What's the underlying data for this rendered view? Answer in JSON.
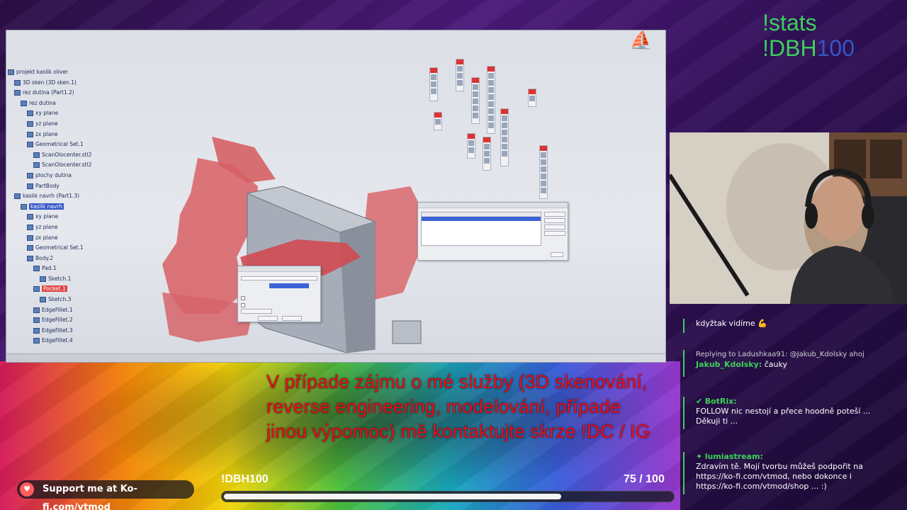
{
  "cad": {
    "tree": [
      {
        "label": "projekt kaslik oliver",
        "indent": 0
      },
      {
        "label": "3D sken (3D sken.1)",
        "indent": 1
      },
      {
        "label": "rez dutina (Part1.2)",
        "indent": 1
      },
      {
        "label": "rez dutina",
        "indent": 2
      },
      {
        "label": "xy plane",
        "indent": 3
      },
      {
        "label": "yz plane",
        "indent": 3
      },
      {
        "label": "zx plane",
        "indent": 3
      },
      {
        "label": "Geometrical Set.1",
        "indent": 3
      },
      {
        "label": "ScanOlocenter.stl2",
        "indent": 4
      },
      {
        "label": "ScanOlocenter.stl2",
        "indent": 4
      },
      {
        "label": "plochy dutina",
        "indent": 3
      },
      {
        "label": "PartBody",
        "indent": 3
      },
      {
        "label": "kaslik navrh (Part1.3)",
        "indent": 1
      },
      {
        "label": "kaslik navrh",
        "indent": 2,
        "style": "sel"
      },
      {
        "label": "xy plane",
        "indent": 3
      },
      {
        "label": "yz plane",
        "indent": 3
      },
      {
        "label": "zx plane",
        "indent": 3
      },
      {
        "label": "Geometrical Set.1",
        "indent": 3
      },
      {
        "label": "Body.2",
        "indent": 3
      },
      {
        "label": "Pad.1",
        "indent": 4
      },
      {
        "label": "Sketch.1",
        "indent": 5
      },
      {
        "label": "Pocket.1",
        "indent": 4,
        "style": "red"
      },
      {
        "label": "Sketch.3",
        "indent": 5
      },
      {
        "label": "EdgeFillet.1",
        "indent": 4
      },
      {
        "label": "EdgeFillet.2",
        "indent": 4
      },
      {
        "label": "EdgeFillet.3",
        "indent": 4
      },
      {
        "label": "EdgeFillet.4",
        "indent": 4
      }
    ]
  },
  "stats": {
    "line1": "!stats",
    "line2_prefix": "!DBH",
    "line2_num": "100"
  },
  "chat": [
    {
      "text": "kdyžtak vidíme 💪"
    },
    {
      "reply": "Replying to Ladushkaa91: @Jakub_Kdolsky ahoj",
      "user": "Jakub_Kdolsky:",
      "text": "čauky"
    },
    {
      "user": "BotRix:",
      "text": "FOLLOW nic nestojí a přece hoodně poteší ... Děkuji ti ..."
    },
    {
      "user": "lumiastream:",
      "text": "Zdravím tě. Mojí tvorbu můžeš podpořit na https://ko-fi.com/vtmod, nebo dokonce i https://ko-fi.com/vtmod/shop ... :)"
    }
  ],
  "caption": "V případe zájmu o mé služby (3D skenování, reverse engineering, modelování, případe jinou výpomoc) mě kontaktujte skrze !DC / IG",
  "kofi": {
    "label": "Support me at Ko-fi.com/vtmod"
  },
  "goal": {
    "name": "!DBH100",
    "current": "75",
    "sep": "/",
    "target": "100",
    "progress": 0.75
  },
  "colors": {
    "accent": "#3ad15a",
    "caption": "#e8101c",
    "scan_mesh": "#d9676c",
    "cad_bg": "#e0e2e8"
  }
}
